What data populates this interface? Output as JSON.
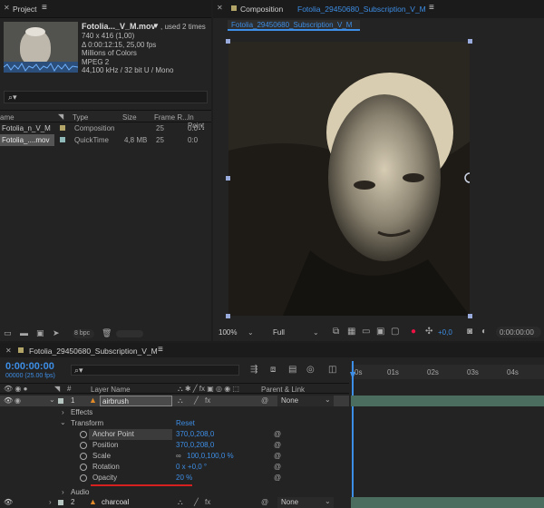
{
  "project": {
    "tab_label": "Project",
    "asset_name": "Fotolia..._V_M.mov",
    "usage": ", used 2 times",
    "info": [
      "740 x 416 (1,00)",
      "Δ 0:00:12:15, 25,00 fps",
      "Millions of Colors",
      "MPEG 2",
      "44,100 kHz / 32 bit U / Mono"
    ],
    "search_placeholder": "",
    "columns": [
      "ame",
      "Type",
      "Size",
      "Frame R...",
      "In Point"
    ],
    "items": [
      {
        "name": "Fotolia_n_V_M",
        "type": "Composition",
        "size": "",
        "fps": "25",
        "in": "0:0",
        "swatch": "#b3a468"
      },
      {
        "name": "Fotolia_....mov",
        "type": "QuickTime",
        "size": "4,8 MB",
        "fps": "25",
        "in": "0:0",
        "swatch": "#8fb8b8"
      }
    ],
    "bpc": "8 bpc"
  },
  "composition": {
    "tab_prefix": "Composition",
    "tab_name": "Fotolia_29450680_Subscription_V_M",
    "subtab": "Fotolia_29450680_Subscription_V_M",
    "zoom": "100%",
    "resolution": "Full",
    "exposure": "+0,0",
    "timecode": "0:00:00:00"
  },
  "timeline": {
    "tab_label": "Fotolia_29450680_Subscription_V_M",
    "current_time": "0:00:00:00",
    "fps_info": "00000 (25.00 fps)",
    "search_placeholder": "",
    "col_layer_name": "Layer Name",
    "col_parent": "Parent & Link",
    "ruler": [
      "0s",
      "01s",
      "02s",
      "03s",
      "04s"
    ],
    "layer1": {
      "index": "1",
      "name": "airbrush",
      "parent": "None"
    },
    "effects": "Effects",
    "transform": "Transform",
    "reset": "Reset",
    "properties": [
      {
        "name": "Anchor Point",
        "value": "370,0,208,0"
      },
      {
        "name": "Position",
        "value": "370,0,208,0"
      },
      {
        "name": "Scale",
        "value": "100,0,100,0 %"
      },
      {
        "name": "Rotation",
        "value": "0 x +0,0 °"
      },
      {
        "name": "Opacity",
        "value": "20 %"
      }
    ],
    "audio": "Audio",
    "layer2": {
      "index": "2",
      "name": "charcoal",
      "parent": "None"
    }
  }
}
